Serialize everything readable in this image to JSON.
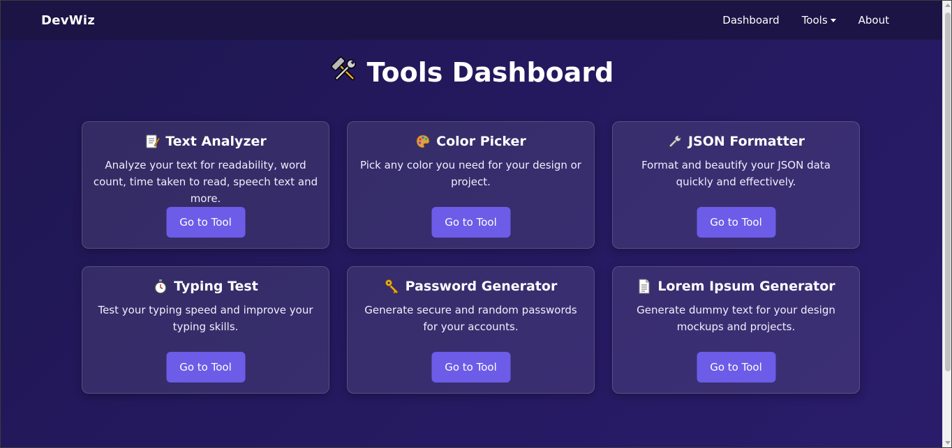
{
  "navbar": {
    "brand": "DevWiz",
    "links": [
      {
        "label": "Dashboard"
      },
      {
        "label": "Tools"
      },
      {
        "label": "About"
      }
    ]
  },
  "page": {
    "title": "Tools Dashboard",
    "title_icon": "hammer-and-wrench-icon"
  },
  "tools": [
    {
      "title": "Text Analyzer",
      "icon": "memo-icon",
      "description": "Analyze your text for readability, word count, time taken to read, speech text and more.",
      "button": "Go to Tool"
    },
    {
      "title": "Color Picker",
      "icon": "palette-icon",
      "description": "Pick any color you need for your design or project.",
      "button": "Go to Tool"
    },
    {
      "title": "JSON Formatter",
      "icon": "wrench-icon",
      "description": "Format and beautify your JSON data quickly and effectively.",
      "button": "Go to Tool"
    },
    {
      "title": "Typing Test",
      "icon": "stopwatch-icon",
      "description": "Test your typing speed and improve your typing skills.",
      "button": "Go to Tool"
    },
    {
      "title": "Password Generator",
      "icon": "key-icon",
      "description": "Generate secure and random passwords for your accounts.",
      "button": "Go to Tool"
    },
    {
      "title": "Lorem Ipsum Generator",
      "icon": "page-icon",
      "description": "Generate dummy text for your design mockups and projects.",
      "button": "Go to Tool"
    }
  ],
  "colors": {
    "background": "#23185a",
    "navbar": "#1b1445",
    "button": "#6c5ce7"
  }
}
